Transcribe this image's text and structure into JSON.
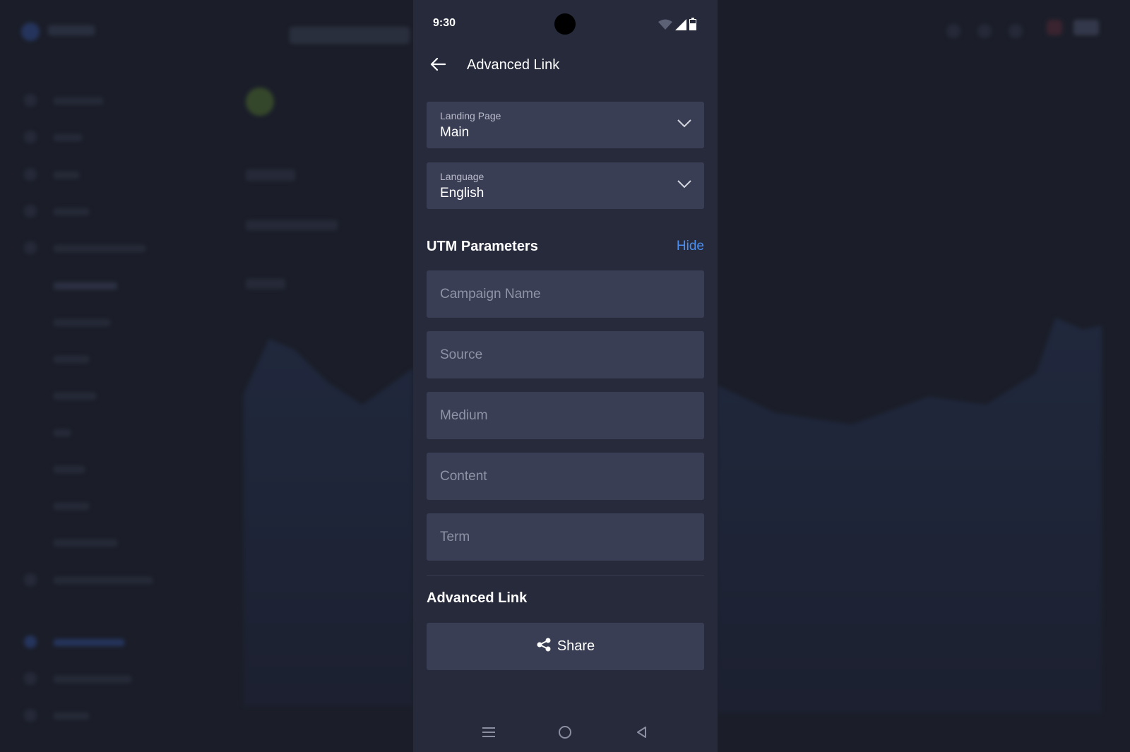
{
  "status_bar": {
    "time": "9:30"
  },
  "app_bar": {
    "title": "Advanced Link"
  },
  "landing_page": {
    "label": "Landing Page",
    "value": "Main"
  },
  "language": {
    "label": "Language",
    "value": "English"
  },
  "utm": {
    "title": "UTM Parameters",
    "toggle_label": "Hide",
    "fields": {
      "campaign": {
        "placeholder": "Campaign Name",
        "value": ""
      },
      "source": {
        "placeholder": "Source",
        "value": ""
      },
      "medium": {
        "placeholder": "Medium",
        "value": ""
      },
      "content": {
        "placeholder": "Content",
        "value": ""
      },
      "term": {
        "placeholder": "Term",
        "value": ""
      }
    }
  },
  "advanced_link": {
    "title": "Advanced Link",
    "share_label": "Share"
  },
  "colors": {
    "accent": "#4d8ff0",
    "field_bg": "#3a3e55",
    "panel_bg": "#262a3b",
    "backdrop": "#1b1e29"
  },
  "icons": [
    "back-arrow-icon",
    "chevron-down-icon",
    "share-icon",
    "wifi-icon",
    "signal-icon",
    "battery-icon",
    "menu-icon",
    "home-icon",
    "back-triangle-icon"
  ]
}
